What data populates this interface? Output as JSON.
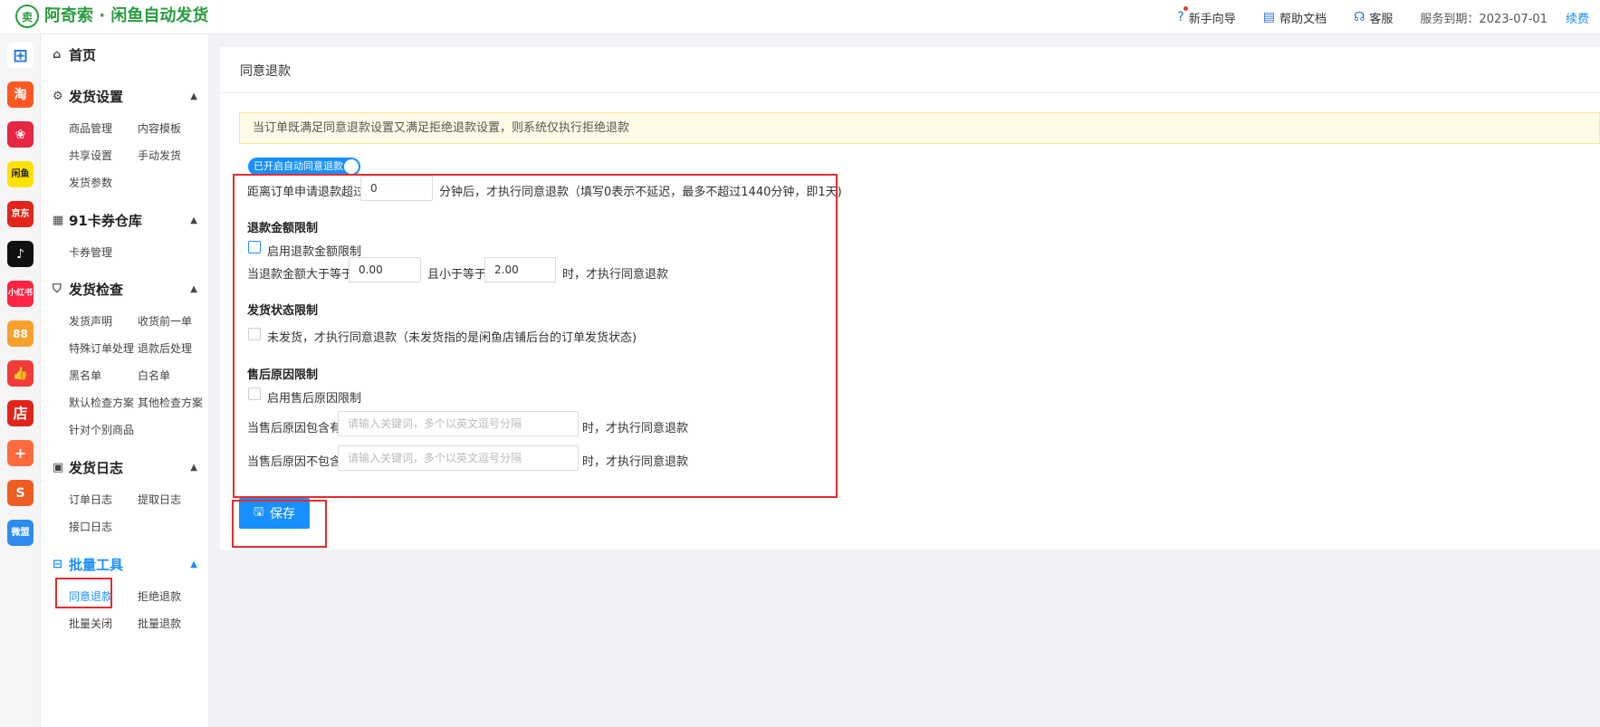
{
  "app": {
    "title": "阿奇索 · 闲鱼自动发货",
    "logo_glyph": "卖"
  },
  "header": {
    "guide": "新手向导",
    "help": "帮助文档",
    "service": "客服",
    "expire": "服务到期：2023-07-01",
    "renew": "续费"
  },
  "rail": [
    {
      "label": "",
      "color": "#ffffff",
      "icon": "grid-apps-icon"
    },
    {
      "label": "淘",
      "color": "#ff5722",
      "icon": "taobao-icon"
    },
    {
      "label": "❀",
      "color": "#e62642",
      "icon": "pinduoduo-icon"
    },
    {
      "label": "闲鱼",
      "color": "#ffe100",
      "icon": "xianyu-icon"
    },
    {
      "label": "京东",
      "color": "#e1251b",
      "icon": "jd-icon"
    },
    {
      "label": "♪",
      "color": "#111111",
      "icon": "douyin-icon"
    },
    {
      "label": "小红书",
      "color": "#ff2442",
      "icon": "xiaohongshu-icon"
    },
    {
      "label": "88",
      "color": "#f7a02d",
      "icon": "kuaishou-icon"
    },
    {
      "label": "👍",
      "color": "#f23a3a",
      "icon": "thumb-icon"
    },
    {
      "label": "店",
      "color": "#e1251b",
      "icon": "shop-icon"
    },
    {
      "label": "+",
      "color": "#ff6a3d",
      "icon": "bag-plus-icon"
    },
    {
      "label": "S",
      "color": "#f05d23",
      "icon": "shopee-icon"
    },
    {
      "label": "微盟",
      "color": "#2d8cf0",
      "icon": "weimob-icon"
    }
  ],
  "sidebar": {
    "home": "首页",
    "g1": {
      "title": "发货设置",
      "items": [
        "商品管理",
        "内容模板",
        "共享设置",
        "手动发货",
        "发货参数"
      ]
    },
    "g2": {
      "title": "91卡券仓库",
      "items": [
        "卡券管理"
      ]
    },
    "g3": {
      "title": "发货检查",
      "items": [
        "发货声明",
        "收货前一单",
        "特殊订单处理",
        "退款后处理",
        "黑名单",
        "白名单",
        "默认检查方案",
        "其他检查方案",
        "针对个别商品"
      ]
    },
    "g4": {
      "title": "发货日志",
      "items": [
        "订单日志",
        "提取日志",
        "接口日志"
      ]
    },
    "g5": {
      "title": "批量工具",
      "items": [
        "同意退款",
        "拒绝退款",
        "批量关闭",
        "批量退款"
      ]
    }
  },
  "main": {
    "title": "同意退款",
    "notice": "当订单既满足同意退款设置又满足拒绝退款设置，则系统仅执行拒绝退款",
    "toggle_label": "已开启自动同意退款",
    "delay_prefix": "距离订单申请退款超过",
    "delay_value": "0",
    "delay_suffix": "分钟后，才执行同意退款（填写0表示不延迟，最多不超过1440分钟，即1天)",
    "amount_section": "退款金额限制",
    "amount_enable": "启用退款金额限制",
    "amount_prefix": "当退款金额大于等于",
    "amount_min": "0.00",
    "amount_mid": "且小于等于",
    "amount_max": "2.00",
    "amount_suffix": "时，才执行同意退款",
    "ship_section": "发货状态限制",
    "ship_option": "未发货，才执行同意退款（未发货指的是闲鱼店铺后台的订单发货状态)",
    "reason_section": "售后原因限制",
    "reason_enable": "启用售后原因限制",
    "reason_include": "当售后原因包含有",
    "reason_exclude": "当售后原因不包含",
    "reason_placeholder": "请输入关键词，多个以英文逗号分隔",
    "reason_suffix": "时，才执行同意退款",
    "save": "保存"
  }
}
